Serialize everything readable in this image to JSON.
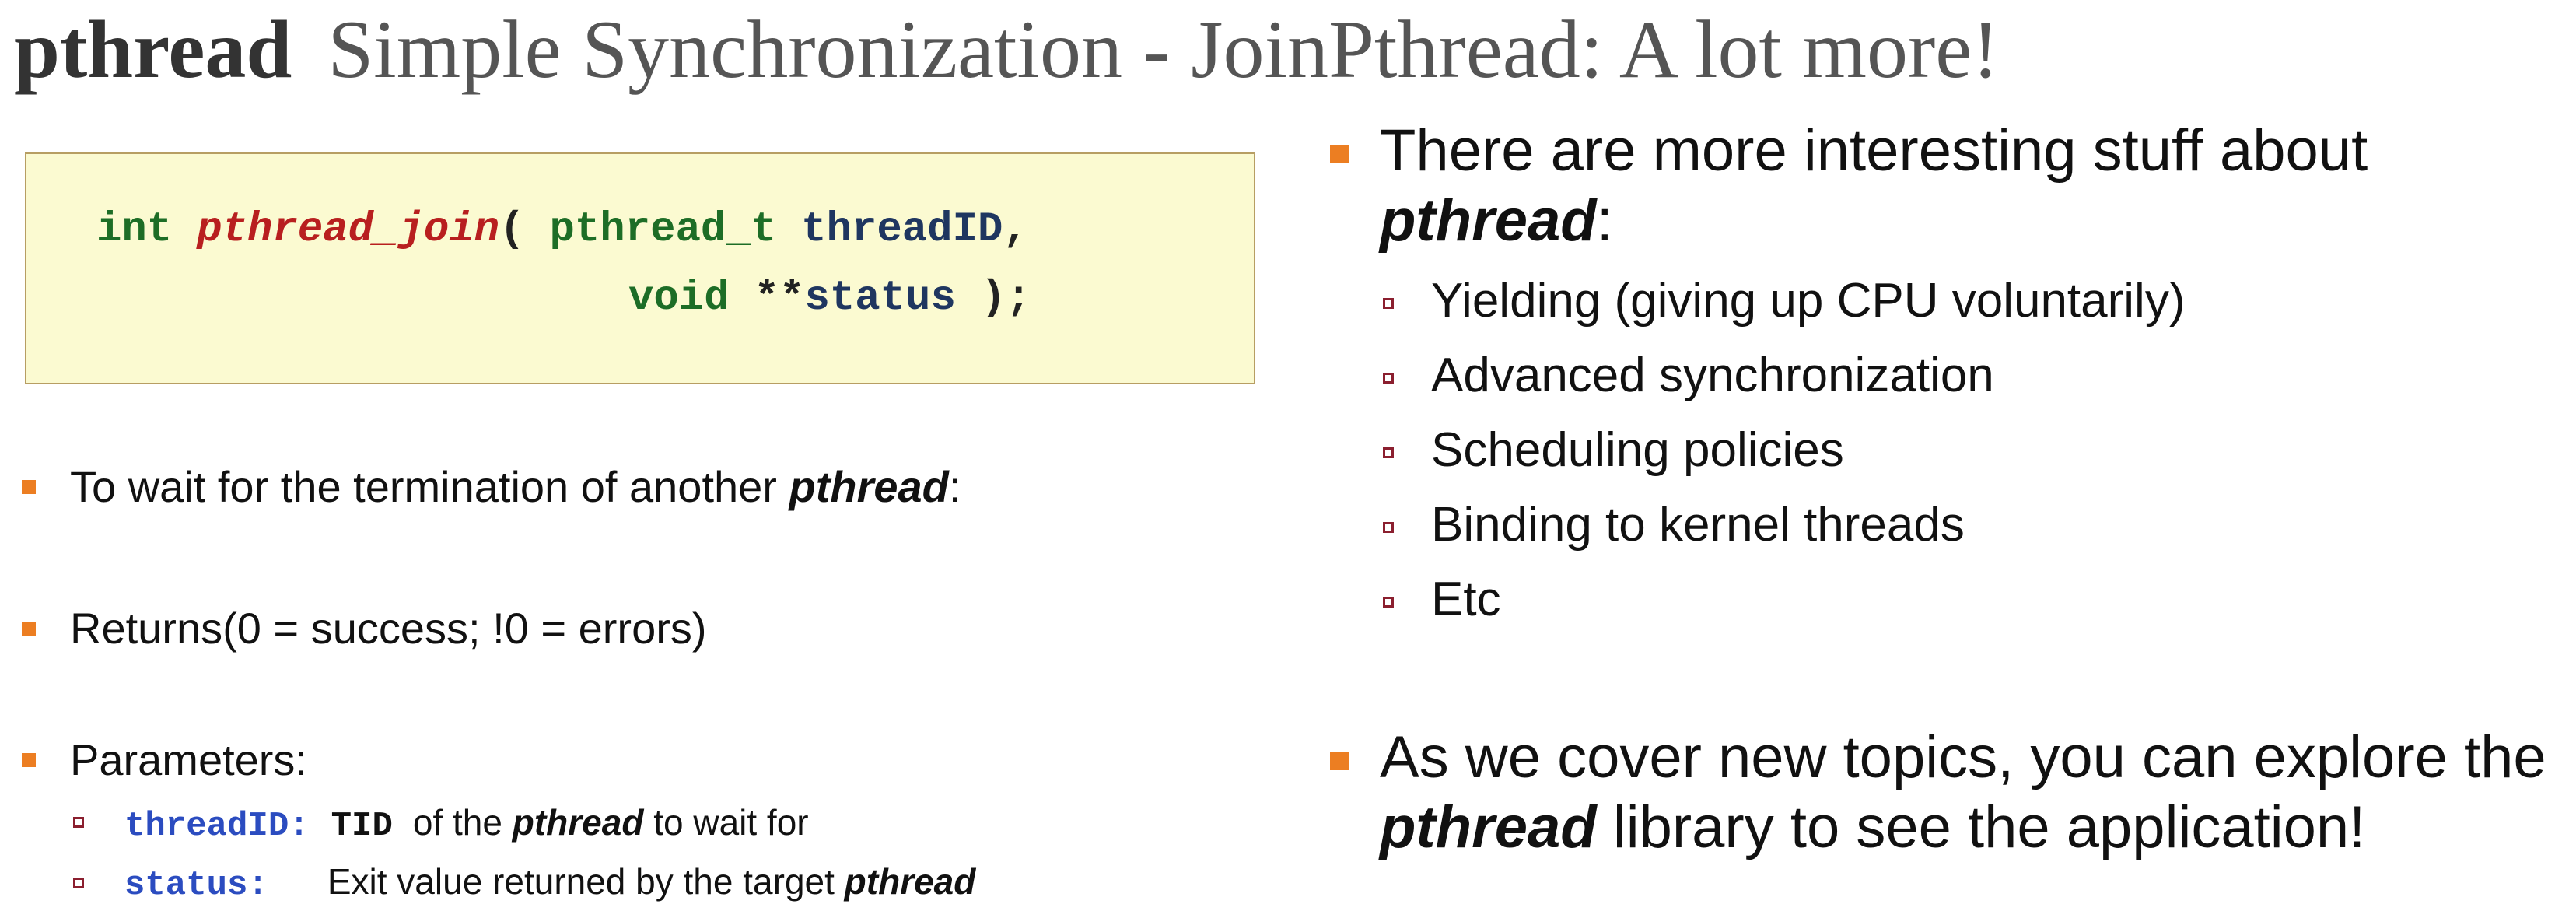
{
  "left_title": {
    "bold": "pthread",
    "rest": "Simple Synchronization - Join"
  },
  "code": {
    "line1": {
      "kw_int": "int",
      "fn_name": "pthread_join",
      "paren_open": "(",
      "type_pthread_t": "pthread_t",
      "param1": "threadID",
      "comma": ","
    },
    "line2": {
      "kw_void": "void",
      "stars": "**",
      "param2": "status",
      "close": ");"
    }
  },
  "left_bullets": [
    {
      "text": "To wait for the termination of another ",
      "em": "pthread",
      "tail": ":"
    },
    {
      "text": "Returns(0 = success; !0 = errors)"
    },
    {
      "text": "Parameters:"
    }
  ],
  "params": [
    {
      "name": "threadID:",
      "tid": "TID",
      "text": "of the ",
      "em": "pthread",
      "tail": " to wait for"
    },
    {
      "name": "status:",
      "text": "Exit value returned by the target ",
      "em": "pthread"
    }
  ],
  "right_title": "Pthread: A lot more!",
  "right_bullets": [
    {
      "text": "There are more interesting stuff about",
      "line2_em": "pthread",
      "line2_tail": ":"
    },
    {
      "text": "As we cover new topics, you can explore the",
      "line2_em": "pthread",
      "line2_tail": " library to see the application!"
    }
  ],
  "right_subitems": [
    "Yielding (giving up CPU voluntarily)",
    "Advanced synchronization",
    "Scheduling policies",
    "Binding to kernel threads",
    "Etc"
  ],
  "colors": {
    "bullet": "#ec7e22",
    "sub_bullet": "#8b1f2f",
    "code_bg": "#fbfad1",
    "code_border": "#b79e63",
    "keyword": "#1d6d26",
    "function": "#b81f1f",
    "identifier": "#1f3660",
    "param_name": "#2b4cc0"
  },
  "icons": {
    "bullet": "orange-square-bullet",
    "sub_bullet": "hollow-square-bullet"
  }
}
